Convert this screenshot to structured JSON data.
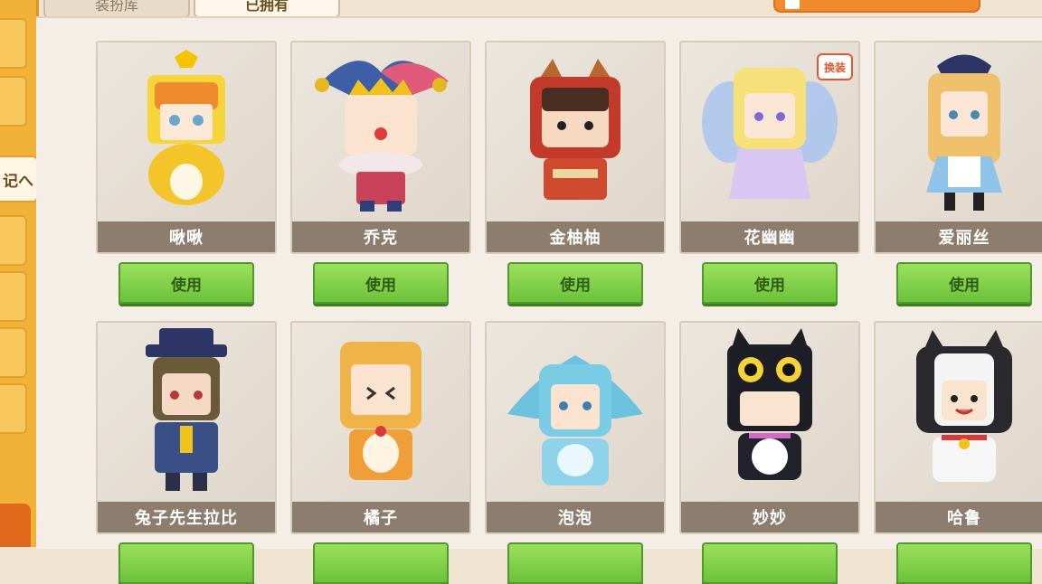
{
  "tabs": [
    {
      "label": "装扮库"
    },
    {
      "label": "已拥有"
    }
  ],
  "sidebar": {
    "tab_label": "记へ"
  },
  "colors": {
    "accent": "#f2b23a",
    "use_button": "#6cc23a",
    "badge": "#e4572e"
  },
  "skins": [
    {
      "name": "啾啾",
      "use_label": "使用",
      "badge": ""
    },
    {
      "name": "乔克",
      "use_label": "使用",
      "badge": ""
    },
    {
      "name": "金柚柚",
      "use_label": "使用",
      "badge": ""
    },
    {
      "name": "花幽幽",
      "use_label": "使用",
      "badge": "换装"
    },
    {
      "name": "爱丽丝",
      "use_label": "使用",
      "badge": ""
    },
    {
      "name": "兔子先生拉比",
      "use_label": "",
      "badge": ""
    },
    {
      "name": "橘子",
      "use_label": "",
      "badge": ""
    },
    {
      "name": "泡泡",
      "use_label": "",
      "badge": ""
    },
    {
      "name": "妙妙",
      "use_label": "",
      "badge": ""
    },
    {
      "name": "哈鲁",
      "use_label": "",
      "badge": ""
    }
  ]
}
